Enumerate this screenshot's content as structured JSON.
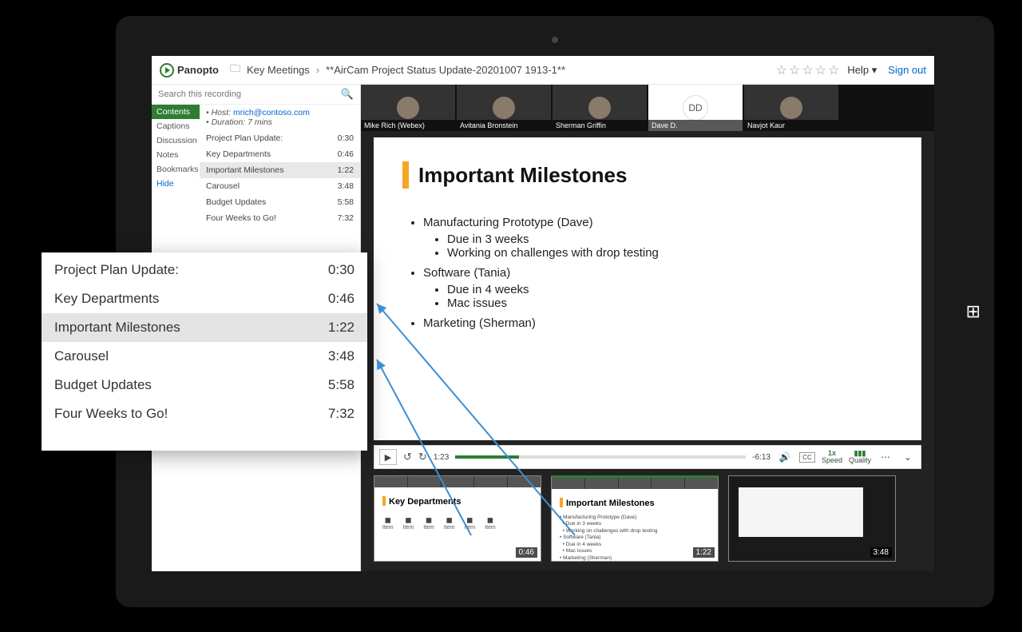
{
  "header": {
    "brand": "Panopto",
    "breadcrumb_folder": "Key Meetings",
    "breadcrumb_title": "**AirCam Project Status Update-20201007 1913-1**",
    "help": "Help",
    "signout": "Sign out"
  },
  "search": {
    "placeholder": "Search this recording"
  },
  "sidebar": {
    "tabs": [
      "Contents",
      "Captions",
      "Discussion",
      "Notes",
      "Bookmarks"
    ],
    "hide": "Hide",
    "host_label": "• Host:",
    "host_value": "mrich@contoso.com",
    "duration": "• Duration: 7 mins",
    "items": [
      {
        "label": "Project Plan Update:",
        "time": "0:30"
      },
      {
        "label": "Key Departments",
        "time": "0:46"
      },
      {
        "label": "Important Milestones",
        "time": "1:22",
        "active": true
      },
      {
        "label": "Carousel",
        "time": "3:48"
      },
      {
        "label": "Budget Updates",
        "time": "5:58"
      },
      {
        "label": "Four Weeks to Go!",
        "time": "7:32"
      }
    ]
  },
  "participants": [
    {
      "name": "Mike Rich (Webex)"
    },
    {
      "name": "Avitania Bronstein"
    },
    {
      "name": "Sherman Griffin"
    },
    {
      "name": "Dave D.",
      "initials": "DD"
    },
    {
      "name": "Navjot Kaur"
    }
  ],
  "slide": {
    "title": "Important Milestones",
    "b1": "Manufacturing Prototype (Dave)",
    "b1a": "Due in 3 weeks",
    "b1b": "Working on challenges with drop testing",
    "b2": "Software (Tania)",
    "b2a": "Due in 4 weeks",
    "b2b": "Mac issues",
    "b3": "Marketing (Sherman)"
  },
  "player": {
    "current": "1:23",
    "remaining": "-6:13",
    "speed_top": "1x",
    "speed_bottom": "Speed",
    "quality_bottom": "Quality",
    "cc": "CC"
  },
  "thumbs": [
    {
      "title": "Key Departments",
      "time": "0:46"
    },
    {
      "title": "Important Milestones",
      "time": "1:22"
    },
    {
      "title": "",
      "time": "3:48"
    }
  ],
  "zoom_panel": {
    "items": [
      {
        "label": "Project Plan Update:",
        "time": "0:30"
      },
      {
        "label": "Key Departments",
        "time": "0:46"
      },
      {
        "label": "Important Milestones",
        "time": "1:22",
        "active": true
      },
      {
        "label": "Carousel",
        "time": "3:48"
      },
      {
        "label": "Budget Updates",
        "time": "5:58"
      },
      {
        "label": "Four Weeks to Go!",
        "time": "7:32"
      }
    ]
  }
}
